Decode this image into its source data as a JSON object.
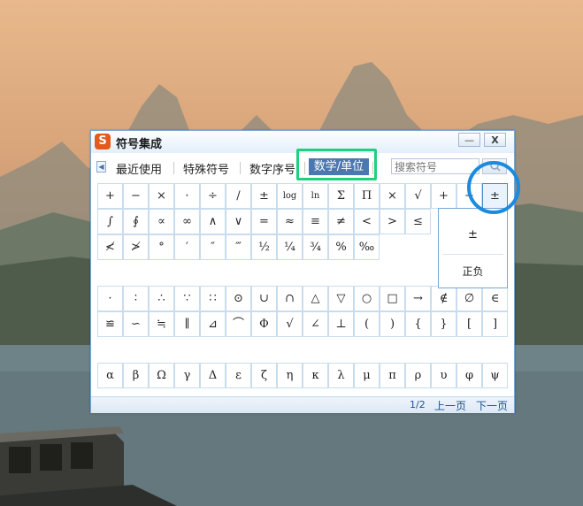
{
  "window": {
    "title": "符号集成",
    "logo_letter": "S",
    "minimize": "—",
    "close": "X"
  },
  "tabs": [
    {
      "label": "最近使用"
    },
    {
      "label": "特殊符号"
    },
    {
      "label": "数字序号"
    },
    {
      "label": "数学/单位"
    }
  ],
  "search": {
    "placeholder": "搜索符号"
  },
  "grid": {
    "row1": [
      "+",
      "−",
      "×",
      "·",
      "÷",
      "/",
      "±",
      "log",
      "ln",
      "Σ",
      "Π",
      "×",
      "√",
      "+",
      "−",
      "±"
    ],
    "row2": [
      "∫",
      "∮",
      "∝",
      "∞",
      "∧",
      "∨",
      "=",
      "≈",
      "≡",
      "≠",
      "<",
      ">",
      "≤"
    ],
    "row3": [
      "≮",
      "≯",
      "°",
      "′",
      "″",
      "‴",
      "½",
      "¼",
      "¾",
      "%",
      "‰"
    ],
    "row4": [
      "·",
      "∶",
      "∴",
      "∵",
      "∷",
      "⊙",
      "∪",
      "∩",
      "△",
      "▽",
      "○",
      "□",
      "→",
      "∉",
      "∅",
      "∈"
    ],
    "row5": [
      "≌",
      "∽",
      "≒",
      "∥",
      "⊿",
      "⌒",
      "Φ",
      "√",
      "∠",
      "⊥",
      "(",
      ")",
      "{",
      "}",
      "[",
      "]"
    ],
    "row6": [
      "α",
      "β",
      "Ω",
      "γ",
      "Δ",
      "ε",
      "ζ",
      "η",
      "κ",
      "λ",
      "μ",
      "π",
      "ρ",
      "υ",
      "φ",
      "ψ"
    ]
  },
  "popup": {
    "symbol": "±",
    "name": "正负"
  },
  "footer": {
    "page": "1/2",
    "prev": "上一页",
    "next": "下一页"
  }
}
